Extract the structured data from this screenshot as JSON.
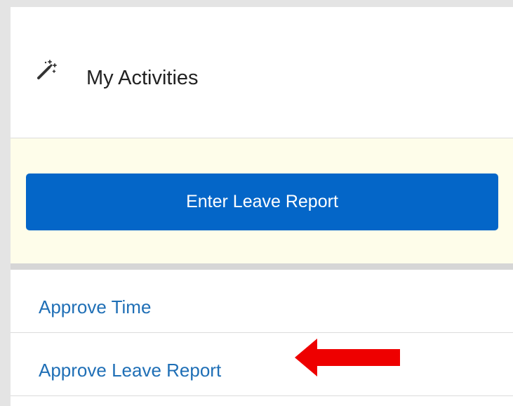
{
  "header": {
    "title": "My Activities",
    "icon": "magic-wand-icon"
  },
  "callout": {
    "primary_button_label": "Enter Leave Report",
    "primary_button_color": "#0466c8",
    "background_color": "#fefdea"
  },
  "activities": [
    {
      "label": "Approve Time"
    },
    {
      "label": "Approve Leave Report"
    }
  ],
  "annotation": {
    "icon": "red-arrow-icon",
    "color": "#ee0000"
  },
  "colors": {
    "link": "#1f6fb6"
  }
}
